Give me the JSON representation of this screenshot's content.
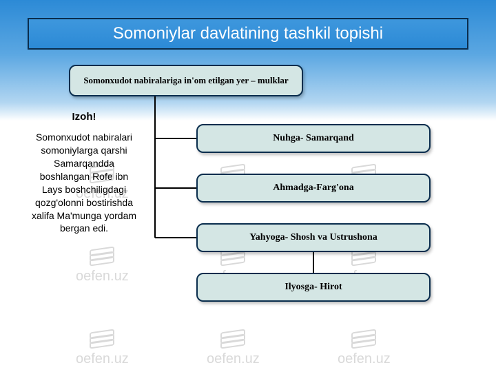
{
  "watermark_text": "oefen.uz",
  "title": "Somoniylar davlatining tashkil topishi",
  "root_label": "Somonxudot nabiralariga  in'om etilgan yer – mulklar",
  "izoh": {
    "heading": "Izoh!",
    "body": "Somonxudot nabiralari somoniylarga qarshi Samarqandda boshlangan Rofe ibn Lays boshchiligdagi qozg'olonni bostirishda  xalifa Ma'munga yordam bergan edi."
  },
  "children": [
    "Nuhga- Samarqand",
    "Ahmadga-Farg'ona",
    "Yahyoga- Shosh va Ustrushona",
    "Ilyosga- Hirot"
  ],
  "colors": {
    "node_fill": "#d4e6e4",
    "node_border": "#0a2d4d",
    "gradient_top": "#2c8ad6",
    "gradient_bottom": "#ffffff",
    "title_text": "#ffffff"
  }
}
